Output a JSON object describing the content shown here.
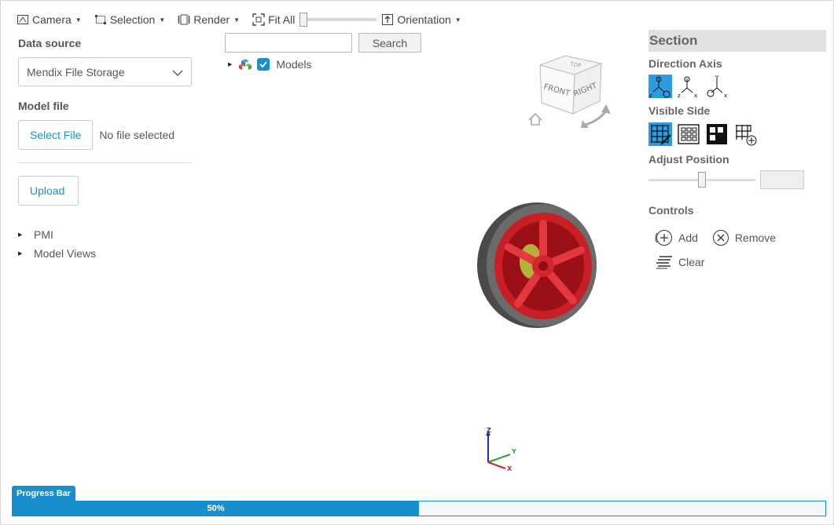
{
  "toolbar": {
    "camera": "Camera",
    "selection": "Selection",
    "render": "Render",
    "fit_all": "Fit All",
    "orientation": "Orientation"
  },
  "left_panel": {
    "data_source_label": "Data source",
    "data_source_value": "Mendix File Storage",
    "model_file_label": "Model file",
    "select_file_button": "Select File",
    "no_file_text": "No file selected",
    "upload_button": "Upload",
    "tree": [
      "PMI",
      "Model Views"
    ]
  },
  "search": {
    "input_value": "",
    "button": "Search"
  },
  "model_tree": {
    "root_label": "Models",
    "checked": true
  },
  "viewcube": {
    "top": "TOP",
    "front": "FRONT",
    "right": "RIGHT"
  },
  "axis_triad": {
    "x": "X",
    "y": "Y",
    "z": "Z"
  },
  "section": {
    "title": "Section",
    "direction_axis_label": "Direction Axis",
    "direction_axes": [
      "z",
      "x",
      "y"
    ],
    "active_axis": "z",
    "visible_side_label": "Visible Side",
    "adjust_position_label": "Adjust Position",
    "position_value": "",
    "slider_fraction": 0.5,
    "controls_label": "Controls",
    "add": "Add",
    "remove": "Remove",
    "clear": "Clear"
  },
  "progress": {
    "tag": "Progress Bar",
    "value_text": "50%",
    "fraction": 0.5
  },
  "colors": {
    "accent": "#1a8fd0",
    "active_icon": "#2c9be0",
    "rim": "#d8232a",
    "tire": "#5a5a5a"
  }
}
